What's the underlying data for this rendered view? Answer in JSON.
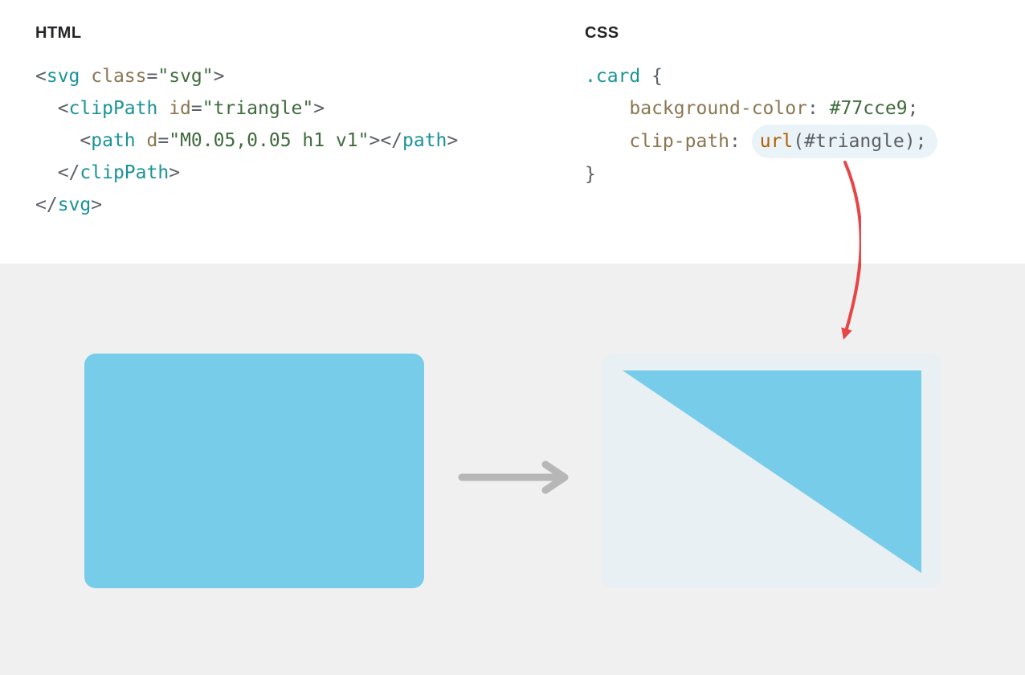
{
  "labels": {
    "html": "HTML",
    "css": "CSS"
  },
  "html_code": {
    "l1": {
      "p1": "<",
      "tag1": "svg",
      "sp": " ",
      "attr1": "class",
      "eq": "=",
      "str1": "\"svg\"",
      "p2": ">"
    },
    "l2": {
      "indent": "  ",
      "p1": "<",
      "tag1": "clipPath",
      "sp": " ",
      "attr1": "id",
      "eq": "=",
      "str1": "\"triangle\"",
      "p2": ">"
    },
    "l3": {
      "indent": "    ",
      "p1": "<",
      "tag1": "path",
      "sp": " ",
      "attr1": "d",
      "eq": "=",
      "str1": "\"M0.05,0.05 h1 v1\"",
      "p2": "></",
      "tag2": "path",
      "p3": ">"
    },
    "l4": {
      "indent": "  ",
      "p1": "</",
      "tag1": "clipPath",
      "p2": ">"
    },
    "l5": {
      "p1": "</",
      "tag1": "svg",
      "p2": ">"
    }
  },
  "css_code": {
    "l1": {
      "sel": ".card",
      "sp": " ",
      "brace": "{"
    },
    "l2": {
      "indent": "    ",
      "prop": "background-color",
      "colon": ": ",
      "val": "#77cce9",
      "semi": ";"
    },
    "l3": {
      "indent": "    ",
      "prop": "clip-path",
      "colon": ": ",
      "fn": "url",
      "arg": "(#triangle);"
    },
    "l4": {
      "brace": "}"
    }
  },
  "colors": {
    "card_bg": "#77cce9",
    "after_bg": "#e8f0f3",
    "arrow_gray": "#b7b7b7",
    "arrow_red": "#e64646"
  }
}
